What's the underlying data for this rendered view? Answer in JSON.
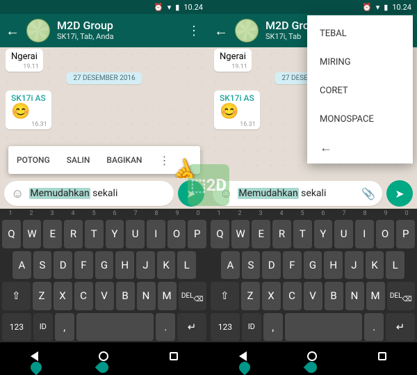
{
  "status": {
    "time": "10.24"
  },
  "header": {
    "title": "M2D Group",
    "subtitle": "SK17i, Tab, Anda",
    "subtitle_cut": "SK17i, Tab"
  },
  "chat": {
    "msg1": {
      "text": "Ngerai",
      "time": "19.11"
    },
    "date": "27 DESEMBER 2016",
    "msg2": {
      "sender": "SK17i AS",
      "emoji": "😊",
      "time": "16.31"
    }
  },
  "toolbar": {
    "cut": "POTONG",
    "copy": "SALIN",
    "share": "BAGIKAN"
  },
  "input": {
    "selected": "Memudahkan",
    "rest": " sekali"
  },
  "context": {
    "bold": "TEBAL",
    "italic": "MIRING",
    "strike": "CORET",
    "mono": "MONOSPACE"
  },
  "keys": {
    "nums": [
      "1",
      "2",
      "3",
      "4",
      "5",
      "6",
      "7",
      "8",
      "9",
      "0"
    ],
    "r1": [
      "Q",
      "W",
      "E",
      "R",
      "T",
      "Y",
      "U",
      "I",
      "O",
      "P"
    ],
    "r2": [
      "A",
      "S",
      "D",
      "F",
      "G",
      "H",
      "J",
      "K",
      "L"
    ],
    "r3": [
      "Z",
      "X",
      "C",
      "V",
      "B",
      "N",
      "M"
    ],
    "shift": "⇧",
    "del": "DEL",
    "num": "123",
    "lang": "ID",
    "comma": ",",
    "dot": ".",
    "enter": "↵"
  }
}
